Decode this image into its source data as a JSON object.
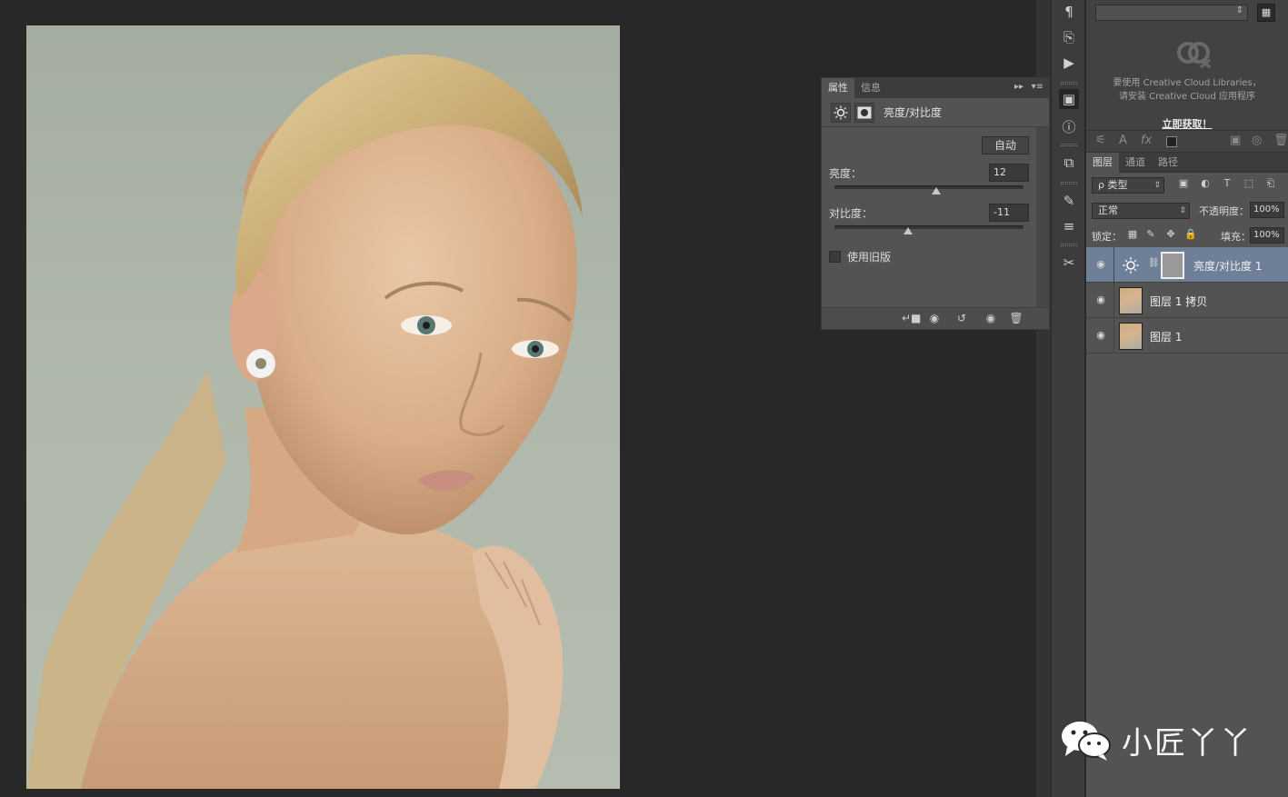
{
  "properties_panel": {
    "tabs": [
      "属性",
      "信息"
    ],
    "title": "亮度/对比度",
    "auto_button": "自动",
    "brightness_label": "亮度：",
    "brightness_value": "12",
    "brightness_fraction": 0.54,
    "contrast_label": "对比度：",
    "contrast_value": "-11",
    "contrast_fraction": 0.39,
    "legacy_label": "使用旧版"
  },
  "libraries": {
    "message_line1": "要使用 Creative Cloud Libraries，",
    "message_line2": "请安装 Creative Cloud 应用程序",
    "link": "立即获取！"
  },
  "layers_panel": {
    "tabs": [
      "图层",
      "通道",
      "路径"
    ],
    "filter_kind": "ρ 类型",
    "blend_mode": "正常",
    "opacity_label": "不透明度：",
    "opacity_value": "100%",
    "lock_label": "锁定：",
    "fill_label": "填充：",
    "fill_value": "100%",
    "layers": [
      {
        "name": "亮度/对比度 1",
        "active": true
      },
      {
        "name": "图层 1 拷贝",
        "active": false
      },
      {
        "name": "图层 1",
        "active": false
      }
    ]
  },
  "watermark": {
    "text": "小匠丫丫"
  },
  "colors": {
    "panel": "#535353",
    "selected_layer": "#6f7f97",
    "canvas_bg": "#282828"
  }
}
